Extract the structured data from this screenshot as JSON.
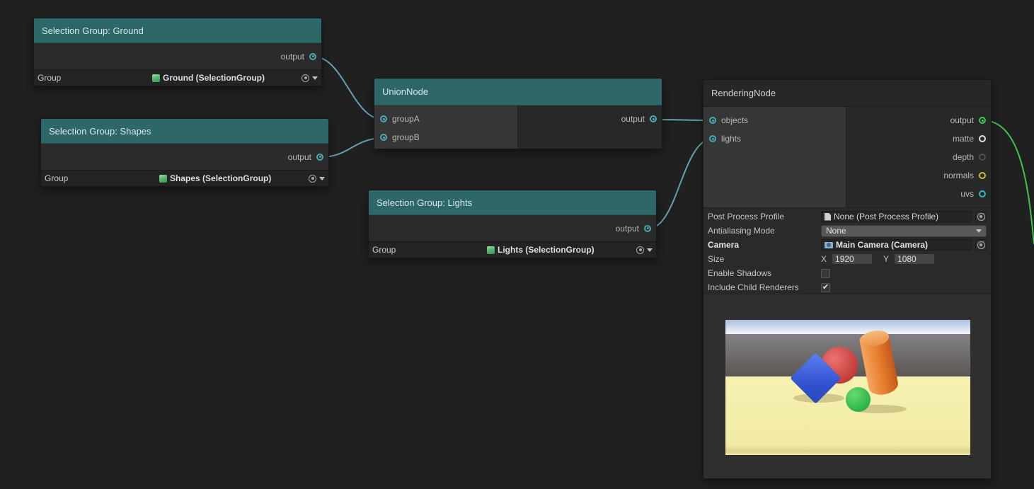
{
  "graph": {
    "background": "#202020"
  },
  "nodes": {
    "ground": {
      "title": "Selection Group: Ground",
      "output": "output",
      "group_label": "Group",
      "group_value": "Ground (SelectionGroup)"
    },
    "shapes": {
      "title": "Selection Group: Shapes",
      "output": "output",
      "group_label": "Group",
      "group_value": "Shapes (SelectionGroup)"
    },
    "lights_group": {
      "title": "Selection Group: Lights",
      "output": "output",
      "group_label": "Group",
      "group_value": "Lights (SelectionGroup)"
    },
    "union": {
      "title": "UnionNode",
      "input_a": "groupA",
      "input_b": "groupB",
      "output": "output"
    },
    "rendering": {
      "title": "RenderingNode",
      "input_objects": "objects",
      "input_lights": "lights",
      "out_output": "output",
      "out_matte": "matte",
      "out_depth": "depth",
      "out_normals": "normals",
      "out_uvs": "uvs",
      "pp_label": "Post Process Profile",
      "pp_value": "None (Post Process Profile)",
      "aa_label": "Antialiasing Mode",
      "aa_value": "None",
      "cam_label": "Camera",
      "cam_value": "Main Camera (Camera)",
      "size_label": "Size",
      "size_x_label": "X",
      "size_x": "1920",
      "size_y_label": "Y",
      "size_y": "1080",
      "shadows_label": "Enable Shadows",
      "shadows_checked": false,
      "children_label": "Include Child Renderers",
      "children_checked": true
    }
  },
  "icons": {
    "check": "✔"
  },
  "colors": {
    "node_header_teal": "#2d6767",
    "wire": "#63a0b0",
    "wire_green": "#43c34a",
    "port_input": "#4aa9b4",
    "port_output_render": "#42c84a",
    "port_matte": "#e0e0e0",
    "port_depth": "#4f4f4f",
    "port_normals": "#cfc23a",
    "port_uvs": "#2fbfbf"
  }
}
